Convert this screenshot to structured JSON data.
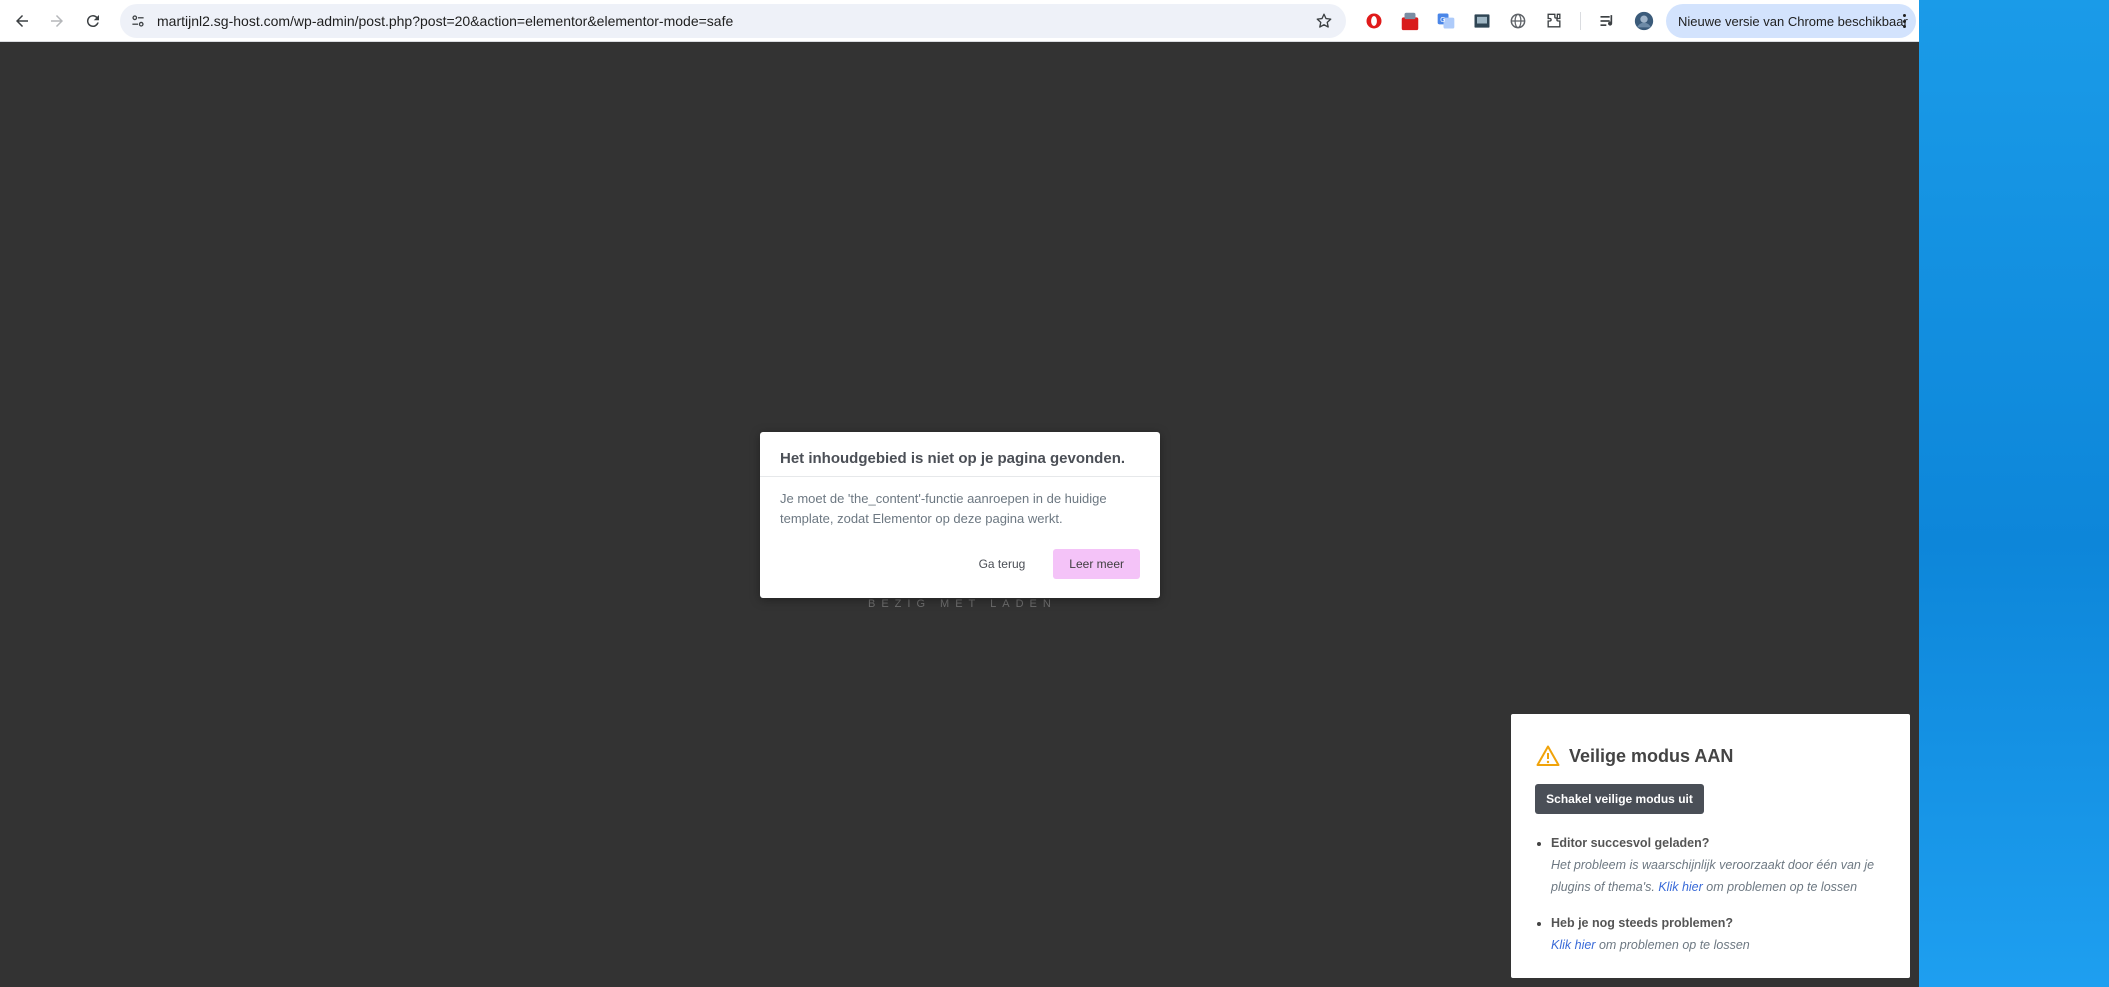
{
  "browser": {
    "url": "martijnl2.sg-host.com/wp-admin/post.php?post=20&action=elementor&elementor-mode=safe",
    "update_notice": "Nieuwe versie van Chrome beschikbaar",
    "icons": [
      "back-icon",
      "forward-icon",
      "reload-icon",
      "site-info-icon",
      "bookmark-star-icon",
      "opera-extension-icon",
      "red-extension-icon",
      "translate-extension-icon",
      "screen-extension-icon",
      "globe-extension-icon",
      "extensions-puzzle-icon",
      "media-queue-icon",
      "profile-avatar-icon",
      "menu-kebab-icon"
    ]
  },
  "page": {
    "loading_text": "BEZIG MET LADEN"
  },
  "dialog": {
    "title": "Het inhoudgebied is niet op je pagina gevonden.",
    "message": "Je moet de 'the_content'-functie aanroepen in de huidige template, zodat Elementor op deze pagina werkt.",
    "back_label": "Ga terug",
    "learn_label": "Leer meer"
  },
  "safe_mode": {
    "title": "Veilige modus AAN",
    "disable_label": "Schakel veilige modus uit",
    "items": [
      {
        "question": "Editor succesvol geladen?",
        "text": "Het probleem is waarschijnlijk veroorzaakt door één van je plugins of thema's.",
        "link": "Klik hier",
        "suffix": "om problemen op te lossen"
      },
      {
        "question": "Heb je nog steeds problemen?",
        "link": "Klik hier",
        "suffix": "om problemen op te lossen"
      }
    ]
  },
  "colors": {
    "editor_bg": "#333333",
    "accent_pink": "#f4c3f8",
    "safe_button": "#4a4f57",
    "link_blue": "#3a6bd8",
    "warning_orange": "#f0a30a"
  }
}
